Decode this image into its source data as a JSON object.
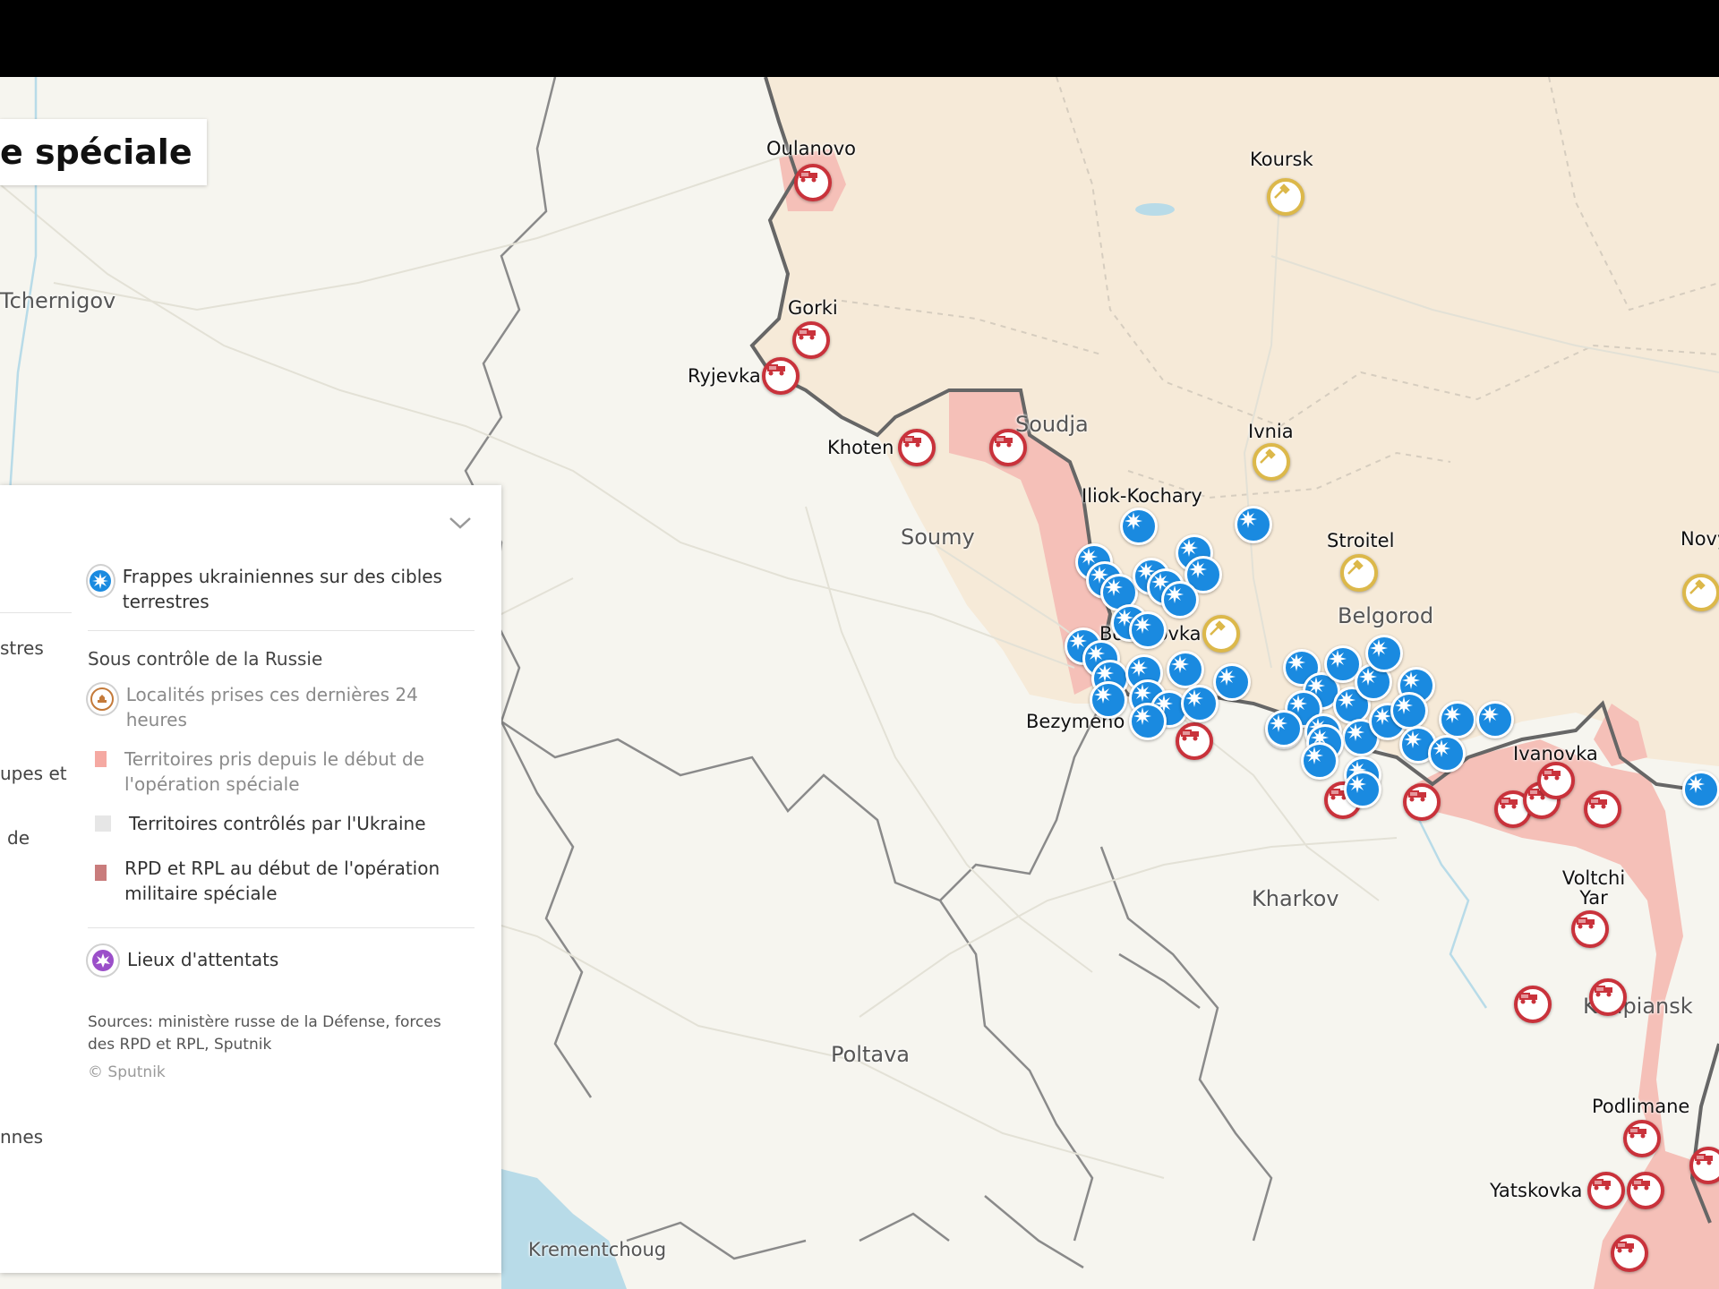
{
  "title": "e spéciale",
  "legend": {
    "strikes_label": "Frappes ukrainiennes sur des cibles terrestres",
    "russia_heading": "Sous contrôle de la Russie",
    "taken_24h": "Localités prises ces dernières 24 heures",
    "taken_since": "Territoires pris depuis le début de l'opération spéciale",
    "ukraine_controlled": "Territoires contrôlés par l'Ukraine",
    "dpr_lpr": "RPD et RPL au début de l'opération militaire spéciale",
    "attacks": "Lieux d'attentats",
    "sources": "Sources: ministère russe de la Défense, forces des RPD et RPL, Sputnik",
    "copyright": "© Sputnik",
    "left_fragments": [
      "stres",
      "upes et",
      "de",
      "nnes"
    ],
    "colors": {
      "strike_blue": "#1a8ae0",
      "red_marker": "#c9323b",
      "gold_marker": "#dcb84a",
      "territory_taken": "#f5a9a2",
      "ukraine_controlled": "#e6e6e6",
      "dpr_lpr": "#c97c7c",
      "russia_land": "#f6ead8",
      "attack_purple": "#9b4fc9"
    },
    "icons": [
      "strike-icon",
      "tank-icon",
      "chevron-down-icon",
      "attack-icon"
    ]
  },
  "cities": [
    {
      "name": "Oulanovo",
      "type": "town"
    },
    {
      "name": "Koursk",
      "type": "town"
    },
    {
      "name": "Tchernigov",
      "type": "city"
    },
    {
      "name": "Gorki",
      "type": "town"
    },
    {
      "name": "Ryjevka",
      "type": "town"
    },
    {
      "name": "Soudja",
      "type": "city"
    },
    {
      "name": "Khoten",
      "type": "town"
    },
    {
      "name": "Ivnia",
      "type": "town"
    },
    {
      "name": "Iliok-Kochary",
      "type": "town"
    },
    {
      "name": "Soumy",
      "type": "city"
    },
    {
      "name": "Stroitel",
      "type": "town"
    },
    {
      "name": "Novy Oskol",
      "type": "town"
    },
    {
      "name": "Borissovka",
      "type": "town"
    },
    {
      "name": "Belgorod",
      "type": "city"
    },
    {
      "name": "Bezymeno",
      "type": "town"
    },
    {
      "name": "Ivanovka",
      "type": "town"
    },
    {
      "name": "Voltchi Yar",
      "type": "town"
    },
    {
      "name": "Kharkov",
      "type": "city"
    },
    {
      "name": "Koupiansk",
      "type": "city"
    },
    {
      "name": "Poltava",
      "type": "city"
    },
    {
      "name": "Podlimane",
      "type": "town"
    },
    {
      "name": "Yatskovka",
      "type": "town"
    },
    {
      "name": "Krementchoug",
      "type": "city"
    }
  ]
}
